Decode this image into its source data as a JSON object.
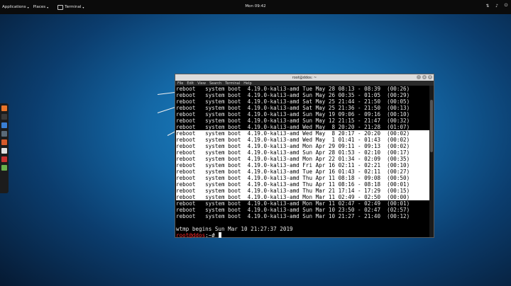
{
  "topbar": {
    "applications": "Applications",
    "places": "Places",
    "task_label": "Terminal",
    "clock": "Mon 09:42",
    "tray_icons": [
      "network-icon",
      "volume-icon",
      "power-icon"
    ]
  },
  "dock": {
    "apps": [
      {
        "name": "dock-app-orange",
        "color": "#e8742a"
      },
      {
        "name": "dock-app-terminal",
        "color": "#3a3a3a"
      },
      {
        "name": "dock-app-blue",
        "color": "#3a7fd4"
      },
      {
        "name": "dock-app-stack",
        "color": "#5a6a78"
      },
      {
        "name": "dock-app-red-orange",
        "color": "#d65a2a"
      },
      {
        "name": "dock-app-white",
        "color": "#e0e0e0"
      },
      {
        "name": "dock-app-red",
        "color": "#c93030"
      },
      {
        "name": "dock-app-green",
        "color": "#6ab04c"
      }
    ]
  },
  "terminal": {
    "title": "root@ddos: ~",
    "menu": [
      "File",
      "Edit",
      "View",
      "Search",
      "Terminal",
      "Help"
    ],
    "rows": [
      {
        "text": "reboot   system boot  4.19.0-kali3-amd Tue May 28 08:13 - 08:39  (00:26)",
        "selected": false
      },
      {
        "text": "reboot   system boot  4.19.0-kali3-amd Sun May 26 00:35 - 01:05  (00:29)",
        "selected": false
      },
      {
        "text": "reboot   system boot  4.19.0-kali3-amd Sat May 25 21:44 - 21:50  (00:05)",
        "selected": false
      },
      {
        "text": "reboot   system boot  4.19.0-kali3-amd Sat May 25 21:36 - 21:50  (00:13)",
        "selected": false
      },
      {
        "text": "reboot   system boot  4.19.0-kali3-amd Sun May 19 09:06 - 09:16  (00:10)",
        "selected": false
      },
      {
        "text": "reboot   system boot  4.19.0-kali3-amd Sun May 12 21:15 - 21:47  (00:32)",
        "selected": false
      },
      {
        "text": "reboot   system boot  4.19.0-kali3-amd Wed May  8 20:20 - 21:28  (01:07)",
        "selected": false
      },
      {
        "text": "reboot   system boot  4.19.0-kali3-amd Wed May  8 20:17 - 20:20  (00:02)",
        "selected": true
      },
      {
        "text": "reboot   system boot  4.19.0-kali3-amd Wed May  1 01:41 - 01:43  (00:02)",
        "selected": true
      },
      {
        "text": "reboot   system boot  4.19.0-kali3-amd Mon Apr 29 09:11 - 09:13  (00:02)",
        "selected": true
      },
      {
        "text": "reboot   system boot  4.19.0-kali3-amd Sun Apr 28 01:53 - 02:10  (00:17)",
        "selected": true
      },
      {
        "text": "reboot   system boot  4.19.0-kali3-amd Mon Apr 22 01:34 - 02:09  (00:35)",
        "selected": true
      },
      {
        "text": "reboot   system boot  4.19.0-kali3-amd Fri Apr 16 02:11 - 02:21  (00:10)",
        "selected": true
      },
      {
        "text": "reboot   system boot  4.19.0-kali3-amd Tue Apr 16 01:43 - 02:11  (00:27)",
        "selected": true
      },
      {
        "text": "reboot   system boot  4.19.0-kali3-amd Thu Apr 11 08:18 - 09:08  (00:50)",
        "selected": true
      },
      {
        "text": "reboot   system boot  4.19.0-kali3-amd Thu Apr 11 08:16 - 08:18  (00:01)",
        "selected": true
      },
      {
        "text": "reboot   system boot  4.19.0-kali3-amd Thu Mar 21 17:14 - 17:29  (00:15)",
        "selected": true
      },
      {
        "text": "reboot   system boot  4.19.0-kali3-amd Mon Mar 11 02:49 - 02:50  (00:00)",
        "selected": true
      },
      {
        "text": "reboot   system boot  4.19.0-kali3-amd Mon Mar 11 02:47 - 02:49  (00:01)",
        "selected": false
      },
      {
        "text": "reboot   system boot  4.19.0-kali3-amd Sun Mar 10 23:50 - 02:47  (02:57)",
        "selected": false
      },
      {
        "text": "reboot   system boot  4.19.0-kali3-amd Sun Mar 10 21:27 - 21:40  (00:12)",
        "selected": false
      }
    ],
    "wtmp_line": "wtmp begins Sun Mar 10 21:27:37 2019",
    "prompt_user": "root@ddos",
    "prompt_rest": ":~# "
  }
}
